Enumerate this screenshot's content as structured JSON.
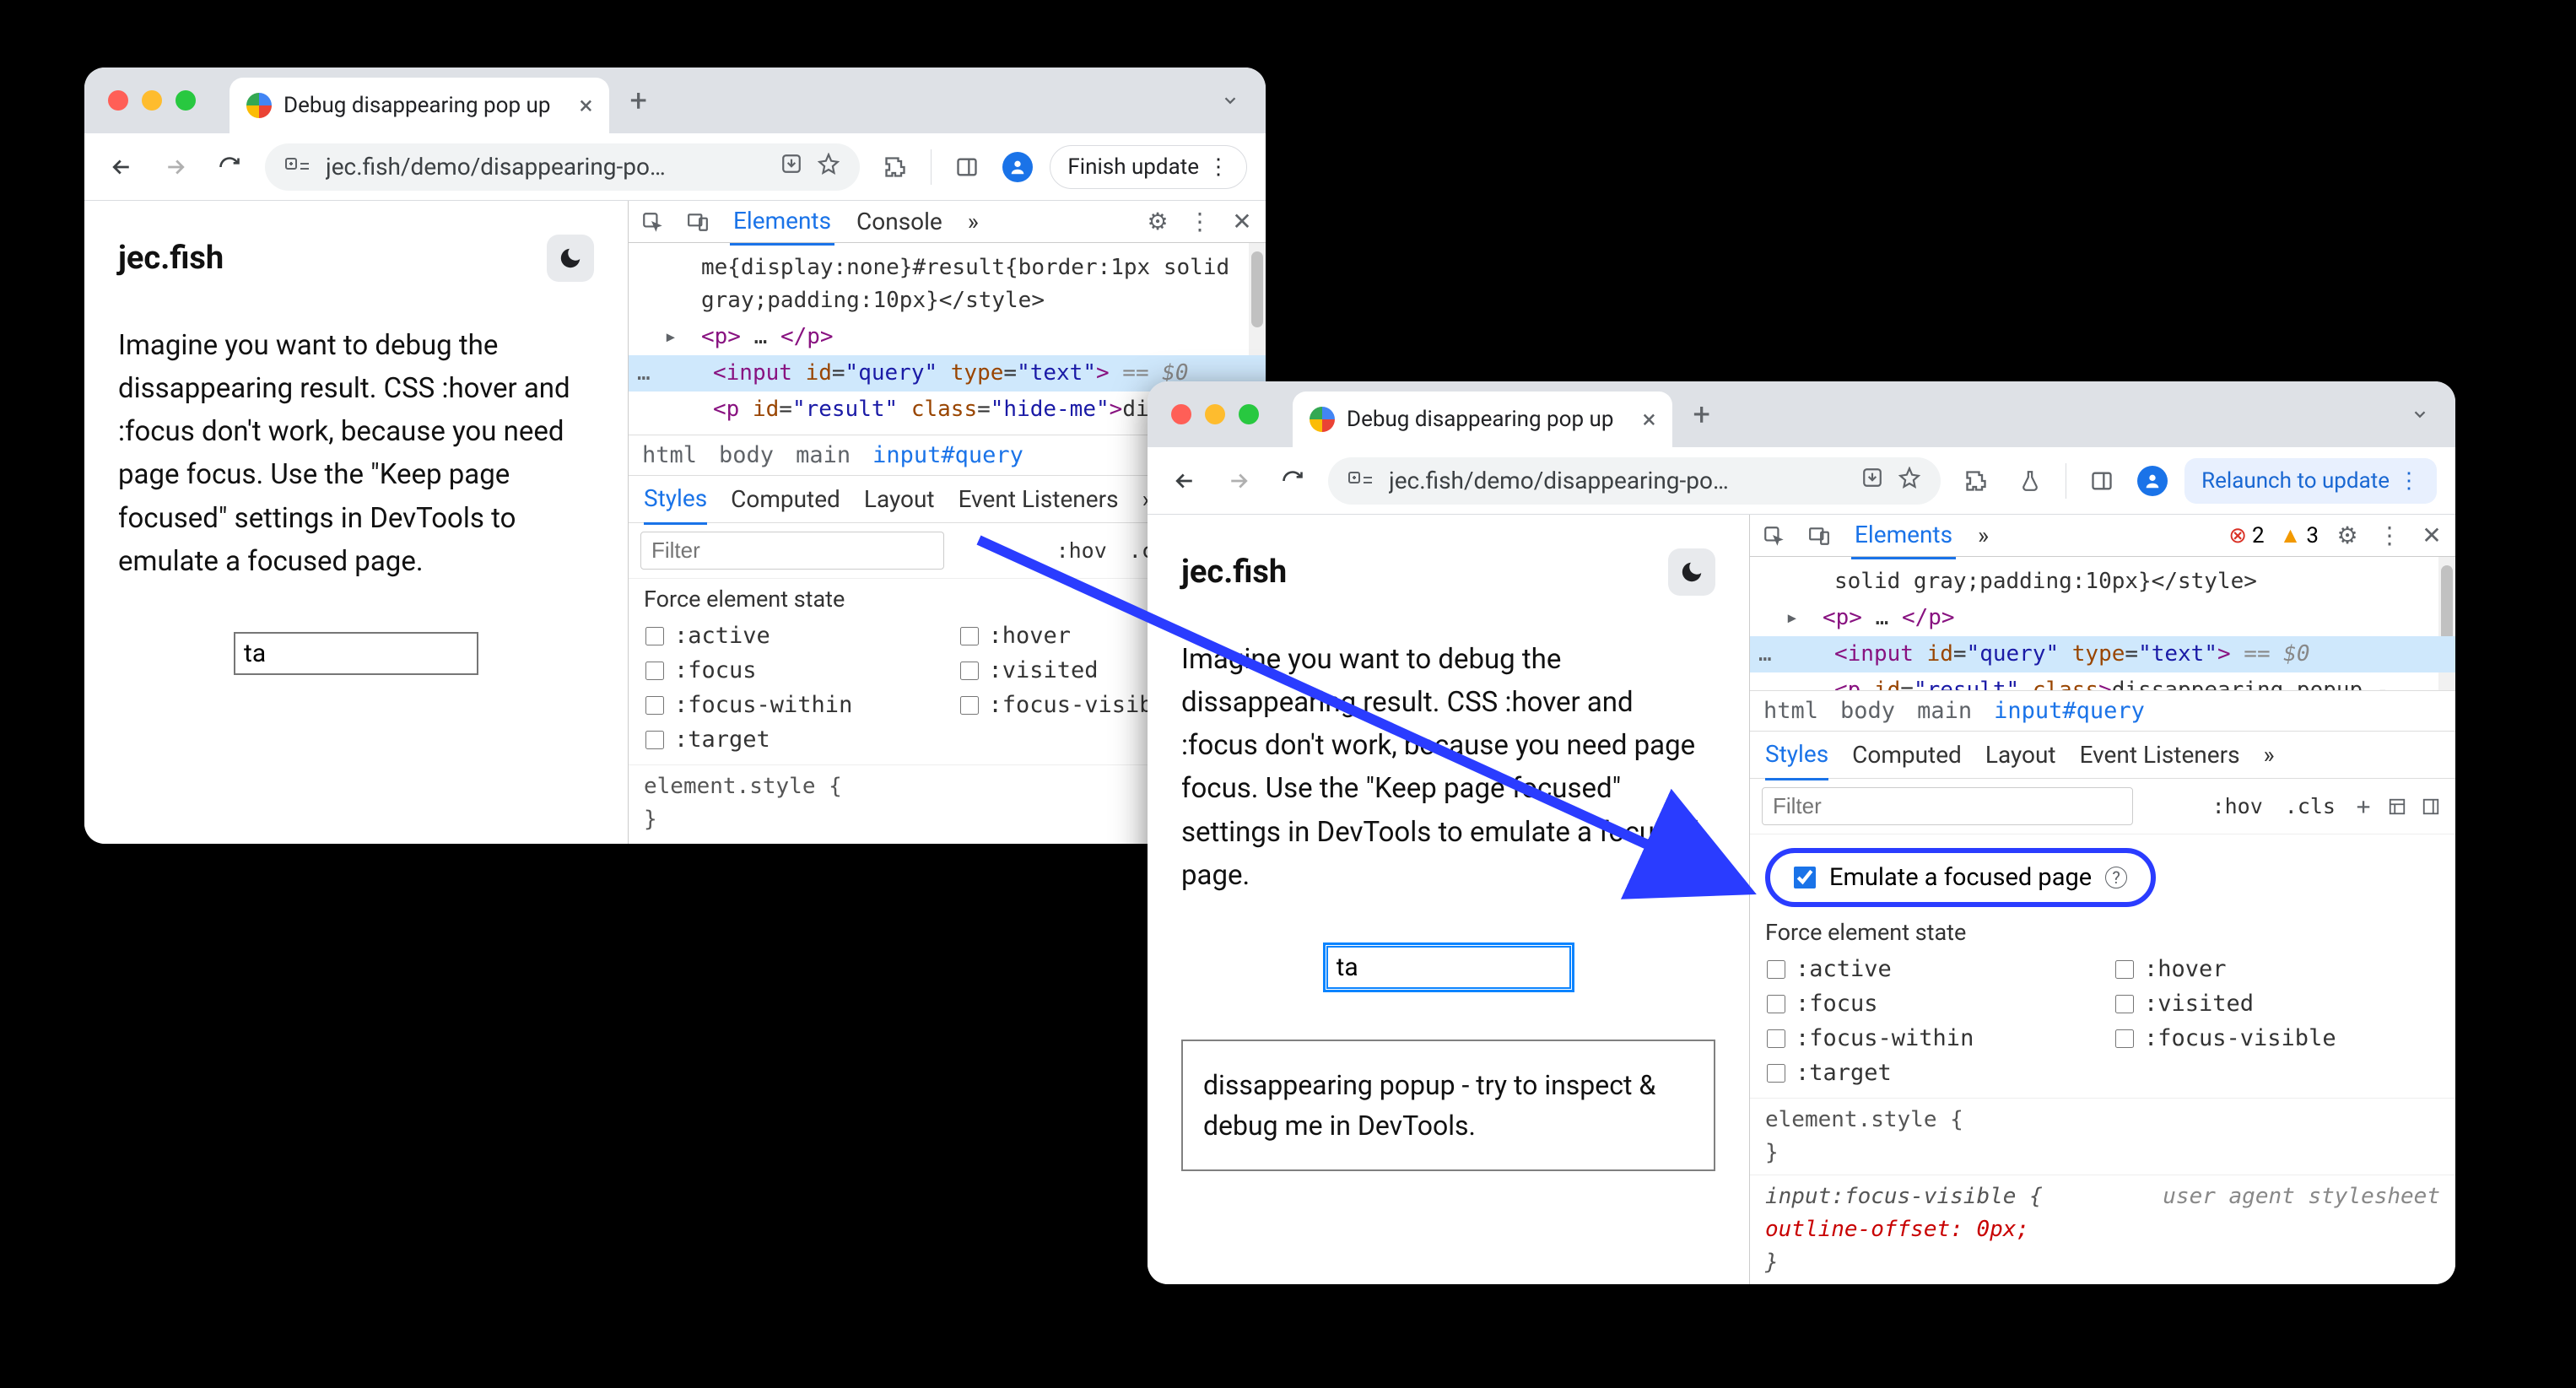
{
  "left": {
    "tab_title": "Debug disappearing pop up",
    "url": "jec.fish/demo/disappearing-po…",
    "update_label": "Finish update",
    "page": {
      "brand": "jec.fish",
      "article": "Imagine you want to debug the dissappearing result. CSS :hover and :focus don't work, because you need page focus. Use the \"Keep page focused\" settings in DevTools to emulate a focused page.",
      "input_value": "ta"
    },
    "devtools": {
      "tabs": {
        "elements": "Elements",
        "console": "Console",
        "more": "»"
      },
      "dom": {
        "line1": "me{display:none}#result{border:1px solid gray;padding:10px}</style>",
        "line2_pre": "▸ <p>",
        "line2_mid": "…",
        "line2_post": "</p>",
        "line3": "<input id=\"query\" type=\"text\">",
        "line3_eq": " == $0",
        "line4": "<p id=\"result\" class=\"hide-me\">dissapp…"
      },
      "breadcrumb": [
        "html",
        "body",
        "main",
        "input#query"
      ],
      "styles_tabs": [
        "Styles",
        "Computed",
        "Layout",
        "Event Listeners",
        "»"
      ],
      "filter_placeholder": "Filter",
      "tool_hov": ":hov",
      "tool_cls": ".cls",
      "force_title": "Force element state",
      "states": [
        ":active",
        ":hover",
        ":focus",
        ":visited",
        ":focus-within",
        ":focus-visible",
        ":target"
      ],
      "element_style": "element.style {",
      "element_style_close": "}"
    }
  },
  "right": {
    "tab_title": "Debug disappearing pop up",
    "url": "jec.fish/demo/disappearing-po…",
    "update_label": "Relaunch to update",
    "page": {
      "brand": "jec.fish",
      "article": "Imagine you want to debug the dissappearing result. CSS :hover and :focus don't work, because you need page focus. Use the \"Keep page focused\" settings in DevTools to emulate a focused page.",
      "input_value": "ta",
      "result": "dissappearing popup - try to inspect & debug me in DevTools."
    },
    "devtools": {
      "tabs": {
        "elements": "Elements",
        "more": "»"
      },
      "err_count": "2",
      "warn_count": "3",
      "dom": {
        "line1": "solid gray;padding:10px}</style>",
        "line2_pre": "▸ <p>",
        "line2_mid": "…",
        "line2_post": "</p>",
        "line3": "<input id=\"query\" type=\"text\">",
        "line3_eq": " == $0",
        "line4": "<p id=\"result\" class>dissappearing popup - try to inspect & debug me in DevTools.</p>"
      },
      "breadcrumb": [
        "html",
        "body",
        "main",
        "input#query"
      ],
      "styles_tabs": [
        "Styles",
        "Computed",
        "Layout",
        "Event Listeners",
        "»"
      ],
      "filter_placeholder": "Filter",
      "tool_hov": ":hov",
      "tool_cls": ".cls",
      "emulate_label": "Emulate a focused page",
      "force_title": "Force element state",
      "states": [
        ":active",
        ":hover",
        ":focus",
        ":visited",
        ":focus-within",
        ":focus-visible",
        ":target"
      ],
      "element_style": "element.style {",
      "element_style_close": "}",
      "rule2_sel": "input:focus-visible {",
      "rule2_ua": "user agent stylesheet",
      "rule2_prop": "  outline-offset: 0px;",
      "rule2_close": "}"
    }
  }
}
